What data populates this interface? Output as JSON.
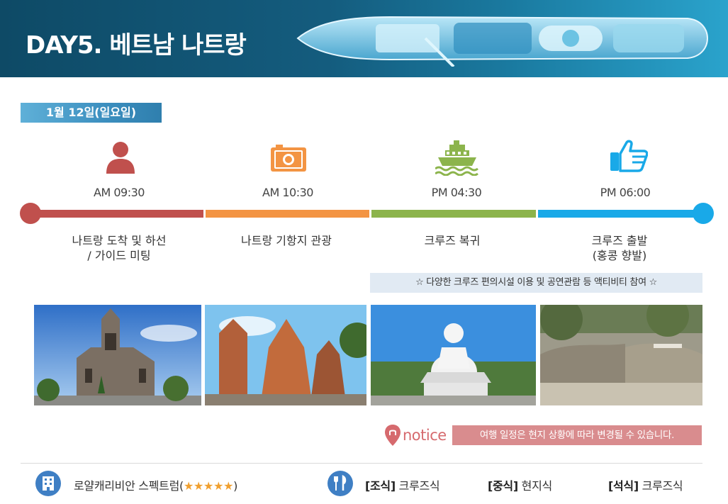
{
  "header": {
    "title": "DAY5. 베트남 나트랑"
  },
  "date": "1월 12일(일요일)",
  "steps": [
    {
      "icon": "person-icon",
      "time": "AM 09:30",
      "desc_line1": "나트랑 도착 및 하선",
      "desc_line2": "/ 가이드 미팅",
      "color": "#c0504d"
    },
    {
      "icon": "camera-icon",
      "time": "AM 10:30",
      "desc_line1": "나트랑 기항지 관광",
      "desc_line2": "",
      "color": "#f39443"
    },
    {
      "icon": "cruise-ship-icon",
      "time": "PM 04:30",
      "desc_line1": "크루즈 복귀",
      "desc_line2": "",
      "color": "#8cb44c"
    },
    {
      "icon": "thumbs-up-icon",
      "time": "PM 06:00",
      "desc_line1": "크루즈 출발",
      "desc_line2": "(홍콩 향발)",
      "color": "#19a9e8"
    }
  ],
  "activity_note": "☆ 다양한 크루즈 편의시설 이용 및 공연관람 등 액티비티 참여 ☆",
  "notice": {
    "label": "notice",
    "message": "여행 일정은 현지 상황에 따라 변경될 수 있습니다."
  },
  "footer": {
    "hotel_name": "로얄캐리비안 스펙트럼(",
    "hotel_stars": "★★★★★",
    "hotel_close": ")",
    "breakfast_label": "[조식]",
    "breakfast_value": " 크루즈식",
    "lunch_label": "[중식]",
    "lunch_value": " 현지식",
    "dinner_label": "[석식]",
    "dinner_value": " 크루즈식"
  }
}
